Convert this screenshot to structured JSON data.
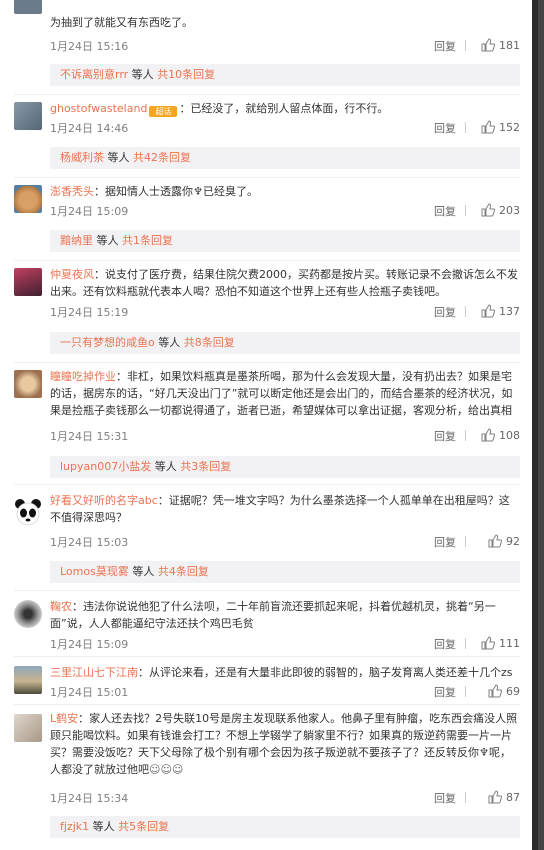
{
  "reply_label": "回复",
  "comments": [
    {
      "user": "",
      "text": "",
      "text_cont": "为抽到了就能又有东西吃了。",
      "date": "1月24日 15:16",
      "likes": "181",
      "sub": {
        "user": "不诉离别意rrr",
        "middle": " 等人 ",
        "count": "共10条回复"
      }
    },
    {
      "user": "ghostofwasteland",
      "text": "：已经没了，就给别人留点体面，行不行。",
      "date": "1月24日 14:46",
      "likes": "152",
      "sub": {
        "user": "杨威利茶",
        "middle": " 等人 ",
        "count": "共42条回复"
      }
    },
    {
      "user": "澎香秃头",
      "text": "：据知情人士透露你",
      "text_b": "已经臭了。",
      "date": "1月24日 15:09",
      "likes": "203",
      "sub": {
        "user": "黯纳里",
        "middle": " 等人 ",
        "count": "共1条回复"
      }
    },
    {
      "user": "仲夏夜风",
      "text": "：说支付了医疗费，结果住院欠费2000，买药都是按片买。转账记录不会撤诉怎么不发出来。还有饮料瓶就代表本人喝？恐怕不知道这个世界上还有些人捡瓶子卖钱吧。",
      "date": "1月24日 15:19",
      "likes": "137",
      "sub": {
        "user": "一只有梦想的咸鱼o",
        "middle": " 等人 ",
        "count": "共8条回复"
      }
    },
    {
      "user": "瞳瞳吃掉作业",
      "text": "：非杠，如果饮料瓶真是墨茶所喝，那为什么会发现大量，没有扔出去？如果是宅的话，据房东的话，“好几天没出门了”就可以断定他还是会出门的，而结合墨茶的经济状况，如果是捡瓶子卖钱那么一切都说得通了，逝者已逝，希望媒体可以拿出证据，客观分析，给出真相",
      "date": "1月24日 15:31",
      "likes": "108",
      "sub": {
        "user": "lupyan007小盐发",
        "middle": " 等人 ",
        "count": "共3条回复"
      }
    },
    {
      "user": "好看又好听的名字abc",
      "text": "：证据呢？凭一堆文字吗？为什么墨茶选择一个人孤单单在出租屋吗？这不值得深思吗？",
      "date": "1月24日 15:03",
      "likes": "92",
      "sub": {
        "user": "Lomos莫现雾",
        "middle": " 等人 ",
        "count": "共4条回复"
      }
    },
    {
      "user": "鞠农",
      "text": "：违法你说说他犯了什么法呗，二十年前盲流还要抓起来呢，抖着优越机灵，挑着“另一面”说，人人都能逼纪守法还扶个鸡巴毛贫",
      "date": "1月24日 15:09",
      "likes": "111"
    },
    {
      "user": "三里江山七下江南",
      "text": "：从评论来看，还是有大量非此即彼的弱智的，脑子发育离人类还差十几个zs",
      "date": "1月24日 15:01",
      "likes": "69"
    },
    {
      "user": "L鹤安",
      "text": "：家人还去找？2号失联10号是房主发现联系他家人。他鼻子里有肿瘤，吃东西会痛没人照顾只能喝饮料。如果有钱谁会打工？不想上学辍学了躺家里不行？如果真的叛逆药需要一片一片买？需要没饭吃？天下父母除了极个别有哪个会因为孩子叛逆就不要孩子了？还反转反你",
      "text_b": "呢，人都没了就放过他吧",
      "date": "1月24日 15:34",
      "likes": "87",
      "sub": {
        "user": "fjzjk1",
        "middle": " 等人 ",
        "count": "共5条回复"
      }
    }
  ],
  "badge": "超话"
}
